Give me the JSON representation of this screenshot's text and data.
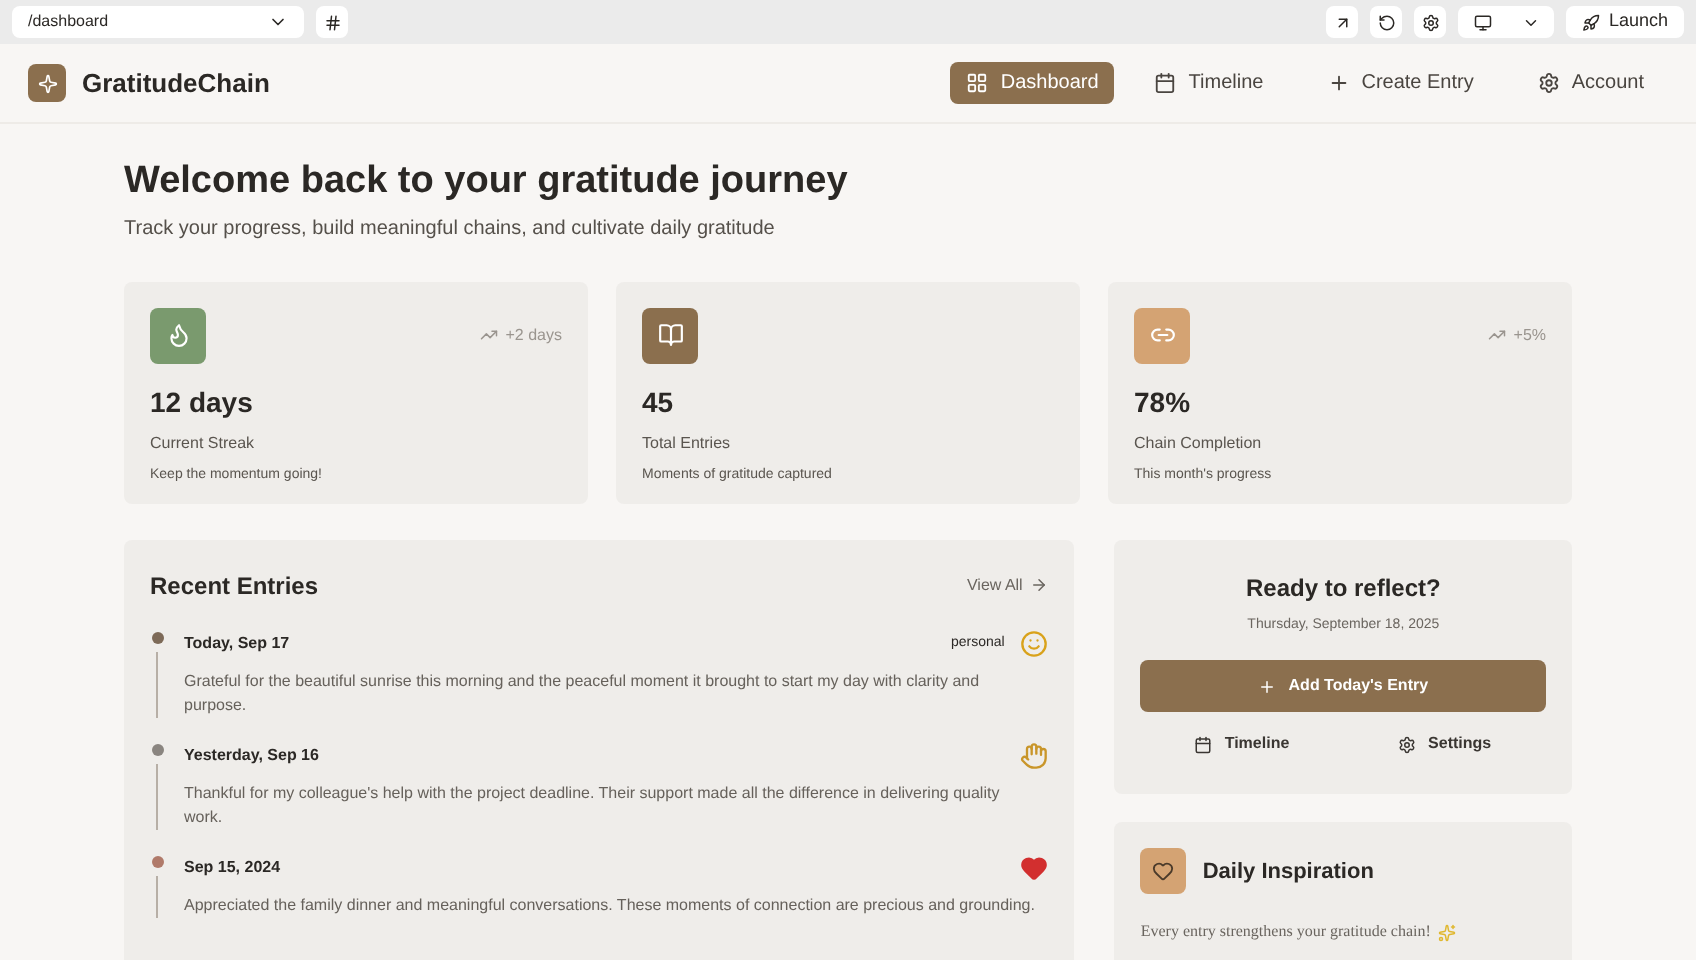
{
  "browser": {
    "url": "/dashboard",
    "launch": "Launch"
  },
  "app": {
    "name": "GratitudeChain"
  },
  "nav": [
    {
      "label": "Dashboard",
      "selected": true
    },
    {
      "label": "Timeline",
      "selected": false
    },
    {
      "label": "Create Entry",
      "selected": false
    },
    {
      "label": "Account",
      "selected": false
    }
  ],
  "header": {
    "title": "Welcome back to your gratitude journey",
    "subtitle": "Track your progress, build meaningful chains, and cultivate daily gratitude"
  },
  "stats": [
    {
      "color": "#7a9a6e",
      "trend": "+2 days",
      "value": "12 days",
      "label": "Current Streak",
      "note": "Keep the momentum going!"
    },
    {
      "color": "#8b6f4e",
      "value": "45",
      "label": "Total Entries",
      "note": "Moments of gratitude captured"
    },
    {
      "color": "#d4a373",
      "trend": "+5%",
      "value": "78%",
      "label": "Chain Completion",
      "note": "This month's progress"
    }
  ],
  "recent": {
    "title": "Recent Entries",
    "view_all": "View All",
    "entries": [
      {
        "date": "Today, Sep 17",
        "tag": "personal",
        "kind": "smile",
        "color": "#7d6a58",
        "text": "Grateful for the beautiful sunrise this morning and the peaceful moment it brought to start my day with clarity and purpose."
      },
      {
        "date": "Yesterday, Sep 16",
        "kind": "hands",
        "color": "#8a8580",
        "text": "Thankful for my colleague's help with the project deadline. Their support made all the difference in delivering quality work."
      },
      {
        "date": "Sep 15, 2024",
        "kind": "heart",
        "color": "#b07a6a",
        "text": "Appreciated the family dinner and meaningful conversations. These moments of connection are precious and grounding."
      }
    ]
  },
  "reflect": {
    "title": "Ready to reflect?",
    "date": "Thursday, September 18, 2025",
    "add": "Add Today's Entry",
    "links": [
      {
        "label": "Timeline"
      },
      {
        "label": "Settings"
      }
    ]
  },
  "inspiration": {
    "title": "Daily Inspiration",
    "text": "Every entry strengthens your gratitude chain!"
  }
}
